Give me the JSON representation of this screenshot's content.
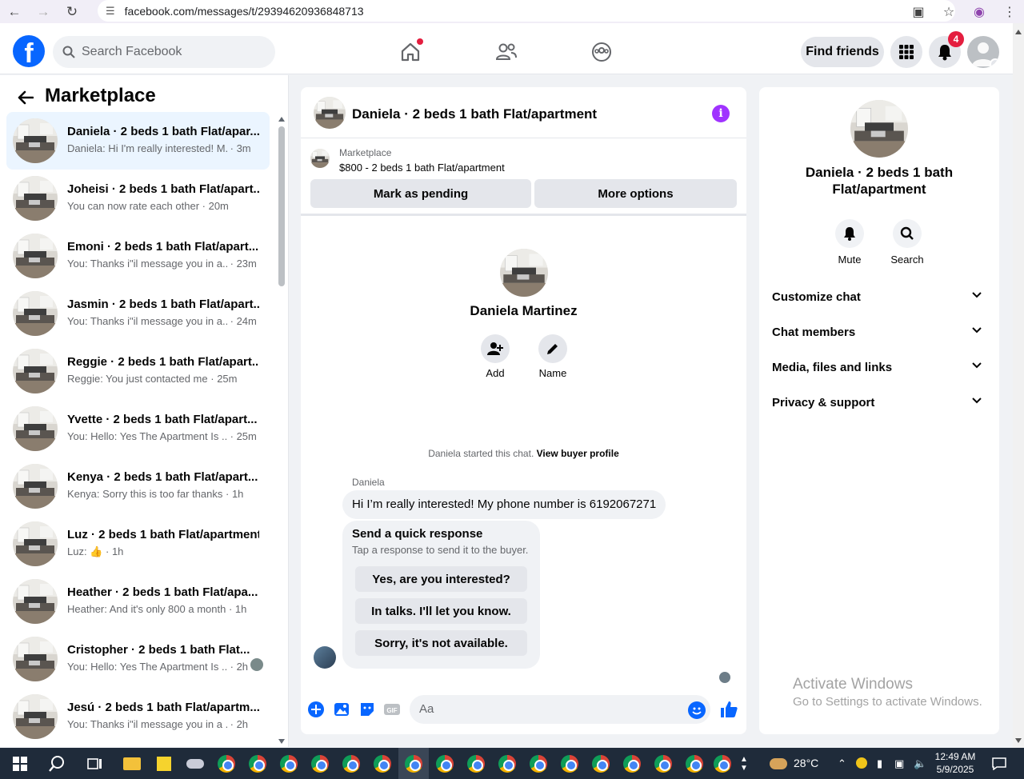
{
  "browser": {
    "url": "facebook.com/messages/t/29394620936848713"
  },
  "topbar": {
    "search_placeholder": "Search Facebook",
    "find_friends": "Find friends",
    "notification_count": "4"
  },
  "sidebar": {
    "title": "Marketplace",
    "conversations": [
      {
        "title": "Daniela · 2 beds 1 bath Flat/apar...",
        "message": "Daniela: Hi I'm really interested! M...",
        "time": "· 3m"
      },
      {
        "title": "Joheisi · 2 beds 1 bath Flat/apart...",
        "message": "You can now rate each other",
        "time": "· 20m"
      },
      {
        "title": "Emoni · 2 beds 1 bath Flat/apart...",
        "message": "You: Thanks i\"il message you in a...",
        "time": "· 23m"
      },
      {
        "title": "Jasmin · 2 beds 1 bath Flat/apart...",
        "message": "You: Thanks i\"il message you in a...",
        "time": "· 24m"
      },
      {
        "title": "Reggie · 2 beds 1 bath Flat/apart...",
        "message": "Reggie: You just contacted me",
        "time": "· 25m"
      },
      {
        "title": "Yvette · 2 beds 1 bath Flat/apart...",
        "message": "You: Hello: Yes The Apartment Is ...",
        "time": "· 25m"
      },
      {
        "title": "Kenya · 2 beds 1 bath Flat/apart...",
        "message": "Kenya: Sorry this is too far thanks",
        "time": "· 1h"
      },
      {
        "title": "Luz · 2 beds 1 bath Flat/apartment",
        "message": "Luz: 👍",
        "time": "· 1h"
      },
      {
        "title": "Heather · 2 beds 1 bath Flat/apa...",
        "message": "Heather: And it's only 800 a month",
        "time": "· 1h"
      },
      {
        "title": "Cristopher · 2 beds 1 bath Flat...",
        "message": "You: Hello: Yes The Apartment Is ...",
        "time": "· 2h"
      },
      {
        "title": "Jesú · 2 beds 1 bath Flat/apartm...",
        "message": "You: Thanks i\"il message you in a ...",
        "time": "· 2h"
      }
    ]
  },
  "chat": {
    "title": "Daniela · 2 beds 1 bath Flat/apartment",
    "listing_category": "Marketplace",
    "listing_price": "$800 - 2 beds 1 bath Flat/apartment",
    "mark_pending": "Mark as pending",
    "more_options": "More options",
    "profile_name": "Daniela Martinez",
    "add_label": "Add",
    "name_label": "Name",
    "started_who": "Daniela started this chat.",
    "view_buyer": "View buyer profile",
    "sender": "Daniela",
    "message": "Hi I’m really interested! My phone number is 6192067271",
    "quick_title": "Send a quick response",
    "quick_sub": "Tap a response to send it to the buyer.",
    "quick_responses": [
      "Yes, are you interested?",
      "In talks. I'll let you know.",
      "Sorry, it's not available."
    ],
    "composer_placeholder": "Aa"
  },
  "info": {
    "title": "Daniela · 2 beds 1 bath Flat/apartment",
    "mute": "Mute",
    "search": "Search",
    "sections": [
      "Customize chat",
      "Chat members",
      "Media, files and links",
      "Privacy & support"
    ]
  },
  "watermark": {
    "line1": "Activate Windows",
    "line2": "Go to Settings to activate Windows."
  },
  "taskbar": {
    "temperature": "28°C",
    "time": "12:49 AM",
    "date": "5/9/2025"
  },
  "colors": {
    "fb_blue": "#0866ff",
    "active_row": "#ebf5ff",
    "info_purple": "#a033ff",
    "badge_red": "#e41e3f"
  }
}
